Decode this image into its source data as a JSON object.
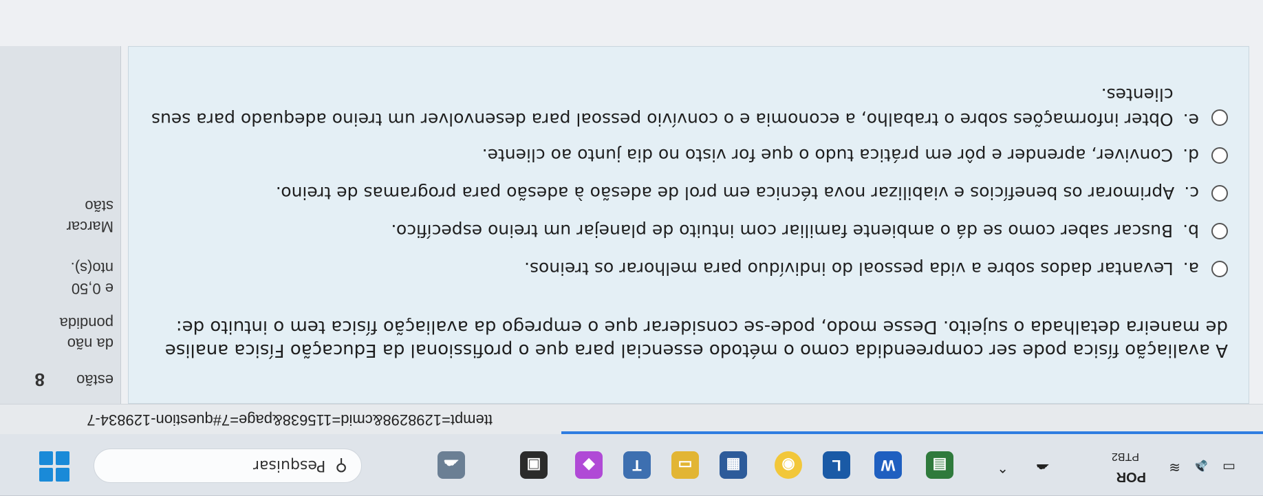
{
  "taskbar": {
    "search_placeholder": "Pesquisar",
    "search_icon": "search-icon",
    "language": "POR",
    "keyboard_layout": "PTB2",
    "accent": "#1a8ad8"
  },
  "browser": {
    "url_fragment": "ttempt=1298298&cmid=115638&page=7#question-129834-7"
  },
  "question_info": {
    "label_fragment": "estão",
    "number": "8",
    "status_line1": "da não",
    "status_line2": "pondida",
    "score": "e 0,50",
    "points_suffix": "nto(s).",
    "flag_label": "Marcar",
    "flag_label2": "stão"
  },
  "question": {
    "text": "A avaliação física pode ser compreendida como o método essencial para que o profissional da Educação Física analise de maneira detalhada o sujeito. Desse modo, pode-se considerar que o emprego da avaliação física tem o intuito de:",
    "options": [
      {
        "letter": "a.",
        "text": "Levantar dados sobre a vida pessoal do indivíduo para melhorar os treinos."
      },
      {
        "letter": "b.",
        "text": "Buscar saber como se dá o ambiente familiar com intuito de planejar um treino específico."
      },
      {
        "letter": "c.",
        "text": "Aprimorar os benefícios e viabilizar nova técnica em prol de adesão à adesão para programas de treino."
      },
      {
        "letter": "d.",
        "text": "Conviver, aprender e pôr em prática tudo o que for visto no dia junto ao cliente."
      },
      {
        "letter": "e.",
        "text": "Obter informações sobre o trabalho, a economia e o convívio pessoal para desenvolver um treino adequado para seus clientes."
      }
    ]
  }
}
